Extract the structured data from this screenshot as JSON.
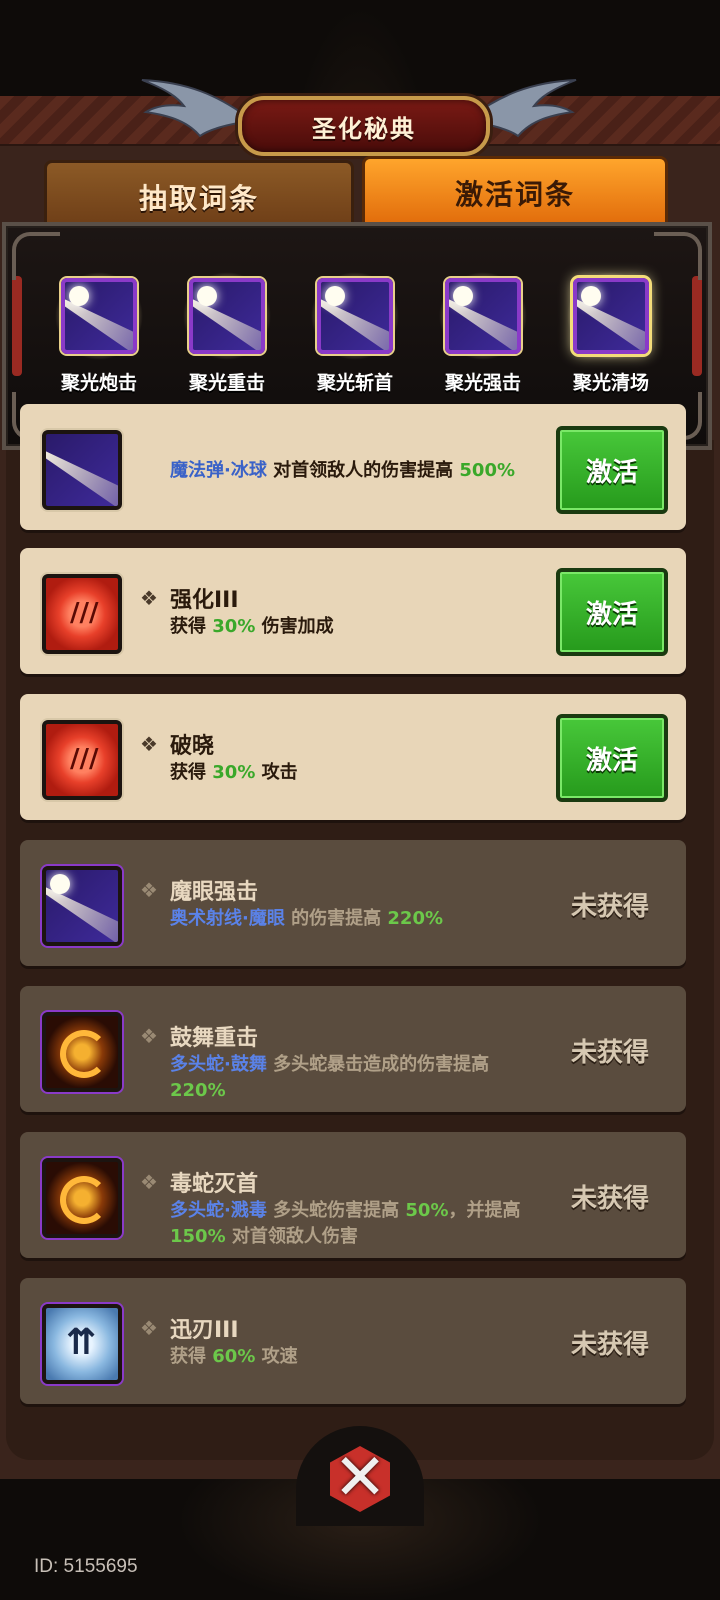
{
  "header": {
    "title": "圣化秘典"
  },
  "tabs": [
    {
      "label": "抽取词条",
      "active": false
    },
    {
      "label": "激活词条",
      "active": true
    }
  ],
  "showcase": [
    {
      "label": "聚光炮击",
      "icon": "light-beam-icon"
    },
    {
      "label": "聚光重击",
      "icon": "light-beam-icon"
    },
    {
      "label": "聚光斩首",
      "icon": "light-beam-icon"
    },
    {
      "label": "聚光强击",
      "icon": "light-beam-icon"
    },
    {
      "label": "聚光清场",
      "icon": "light-beam-icon",
      "highlighted": true
    }
  ],
  "entries": [
    {
      "name": "",
      "desc_parts": [
        {
          "text": "魔法弹·冰球",
          "style": "blue"
        },
        {
          "text": " 对首领敌人的伤害提高 ",
          "style": "normal"
        },
        {
          "text": "500%",
          "style": "green"
        }
      ],
      "icon": "light-beam-icon",
      "state": "active",
      "action": "激活"
    },
    {
      "name": "强化III",
      "desc_parts": [
        {
          "text": "获得 ",
          "style": "normal"
        },
        {
          "text": "30%",
          "style": "green"
        },
        {
          "text": " 伤害加成",
          "style": "normal"
        }
      ],
      "icon": "red-claw-icon",
      "state": "active",
      "action": "激活"
    },
    {
      "name": "破晓",
      "desc_parts": [
        {
          "text": "获得 ",
          "style": "normal"
        },
        {
          "text": "30%",
          "style": "green"
        },
        {
          "text": " 攻击",
          "style": "normal"
        }
      ],
      "icon": "red-claw-icon",
      "state": "active",
      "action": "激活"
    },
    {
      "name": "魔眼强击",
      "desc_parts": [
        {
          "text": "奥术射线·魔眼",
          "style": "blue"
        },
        {
          "text": " 的伤害提高 ",
          "style": "normal"
        },
        {
          "text": "220%",
          "style": "green"
        }
      ],
      "icon": "light-beam-icon",
      "state": "locked",
      "action": "未获得"
    },
    {
      "name": "鼓舞重击",
      "desc_parts": [
        {
          "text": "多头蛇·鼓舞",
          "style": "blue"
        },
        {
          "text": " 多头蛇暴击造成的伤害提高 ",
          "style": "normal"
        },
        {
          "text": "220%",
          "style": "green"
        }
      ],
      "icon": "fire-dragon-icon",
      "state": "locked",
      "action": "未获得"
    },
    {
      "name": "毒蛇灭首",
      "desc_parts": [
        {
          "text": "多头蛇·溅毒",
          "style": "blue"
        },
        {
          "text": " 多头蛇伤害提高 ",
          "style": "normal"
        },
        {
          "text": "50%",
          "style": "green"
        },
        {
          "text": "，并提高 ",
          "style": "normal"
        },
        {
          "text": "150%",
          "style": "green"
        },
        {
          "text": " 对首领敌人伤害",
          "style": "normal"
        }
      ],
      "icon": "fire-dragon-icon",
      "state": "locked",
      "action": "未获得"
    },
    {
      "name": "迅刃III",
      "desc_parts": [
        {
          "text": "获得 ",
          "style": "normal"
        },
        {
          "text": "60%",
          "style": "green"
        },
        {
          "text": " 攻速",
          "style": "normal"
        }
      ],
      "icon": "blue-blade-icon",
      "state": "locked",
      "action": "未获得"
    }
  ],
  "footer": {
    "user_id": "ID: 5155695"
  },
  "colors": {
    "accent_green": "#3aa82a",
    "skill_blue": "#3a62c8",
    "active_tab": "#ffa52c",
    "close_red": "#c8302a"
  }
}
